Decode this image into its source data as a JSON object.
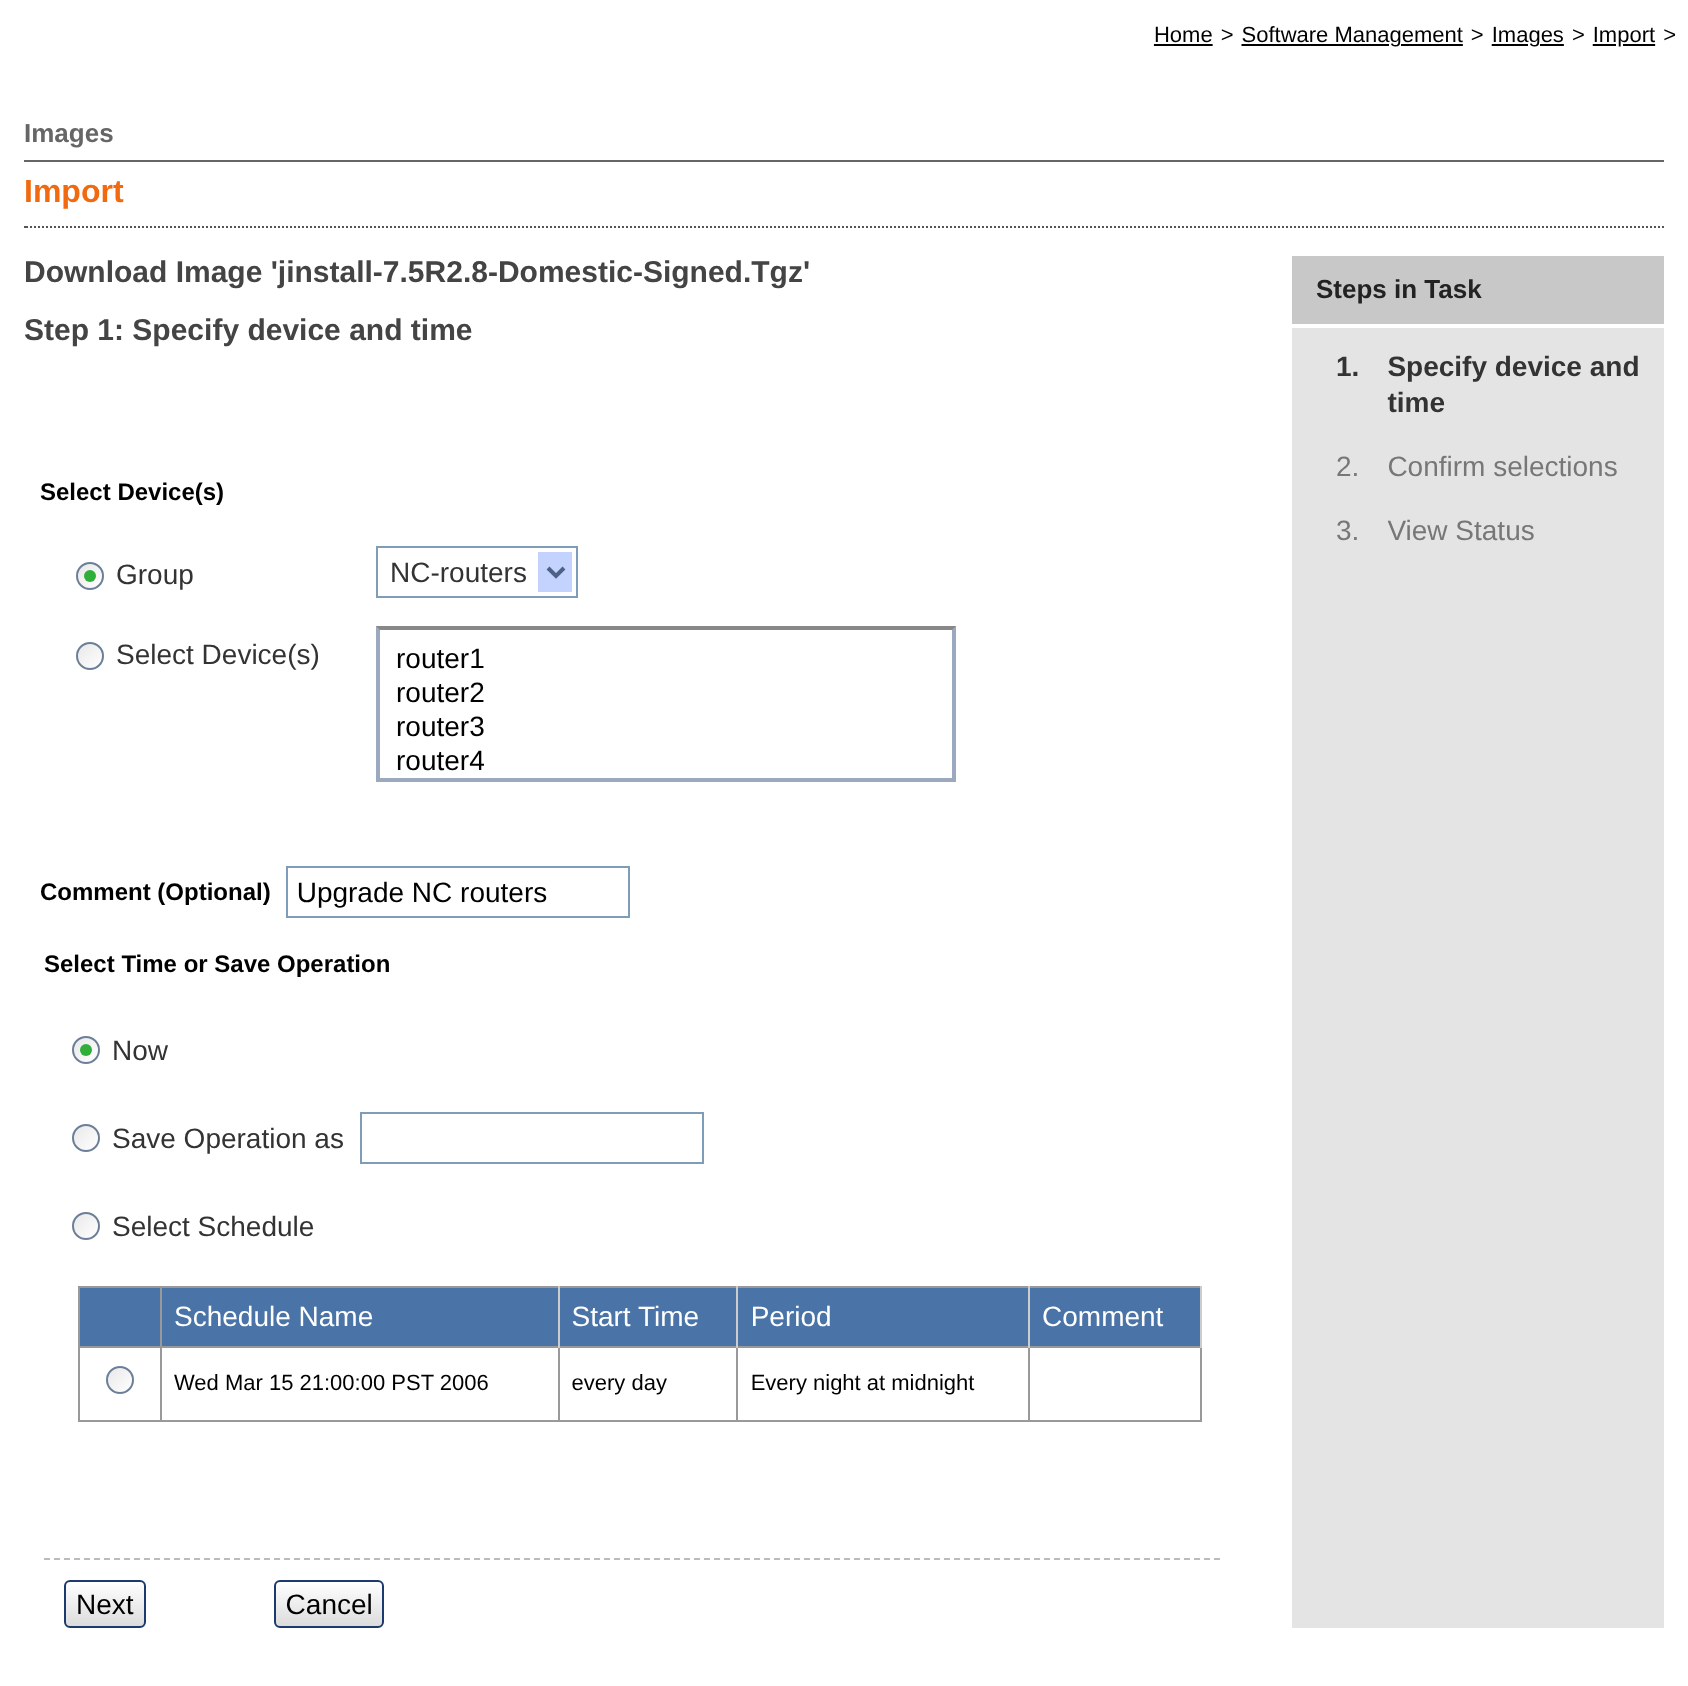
{
  "breadcrumb": [
    {
      "label": "Home",
      "separator": ">"
    },
    {
      "label": "Software Management",
      "separator": ">"
    },
    {
      "label": "Images",
      "separator": ">"
    },
    {
      "label": "Import",
      "separator": ">"
    }
  ],
  "section": "Images",
  "page_title": "Import",
  "heading": "Download Image 'jinstall-7.5R2.8-Domestic-Signed.Tgz'",
  "subheading": "Step 1: Specify device and time",
  "steps_panel": {
    "title": "Steps in Task",
    "steps": [
      {
        "number": "1.",
        "label": "Specify device and time",
        "selected": true
      },
      {
        "number": "2.",
        "label": "Confirm selections",
        "selected": false
      },
      {
        "number": "3.",
        "label": "View Status",
        "selected": false
      }
    ]
  },
  "device_section": {
    "title": "Select Device(s)",
    "options": [
      {
        "kind": "dropdown",
        "label": "Group",
        "selected": true,
        "value": "NC-routers"
      },
      {
        "kind": "list",
        "label": "Select Device(s)",
        "selected": false,
        "items": [
          "router1",
          "router2",
          "router3",
          "router4"
        ]
      }
    ]
  },
  "comment": {
    "label": "Comment (Optional)",
    "value": "Upgrade NC routers"
  },
  "time_section": {
    "title": "Select Time or Save Operation",
    "options": [
      {
        "kind": "plain",
        "label": "Now",
        "selected": true
      },
      {
        "kind": "input",
        "label": "Save Operation as",
        "selected": false
      },
      {
        "kind": "plain",
        "label": "Select Schedule",
        "selected": false
      }
    ]
  },
  "schedule_table": {
    "columns": [
      "Schedule Name",
      "Start Time",
      "Period",
      "Comment"
    ],
    "rows": [
      {
        "selected": false,
        "cells": [
          "Wed Mar 15 21:00:00 PST 2006",
          "every day",
          "Every night at midnight"
        ]
      }
    ]
  },
  "buttons": [
    "Next",
    "Cancel"
  ]
}
